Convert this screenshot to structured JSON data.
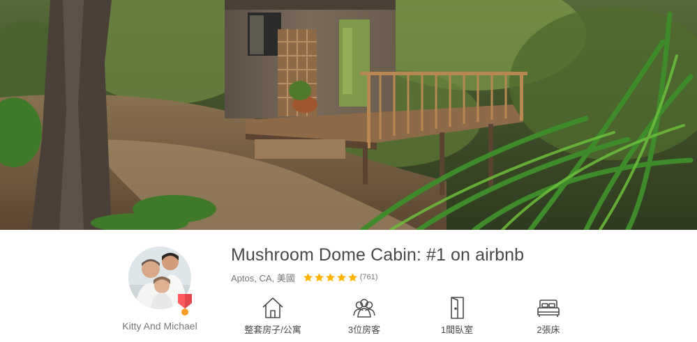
{
  "listing": {
    "title": "Mushroom Dome Cabin: #1 on airbnb",
    "location": "Aptos, CA, 美國",
    "rating_stars": 5,
    "review_count": "(761)"
  },
  "host": {
    "name": "Kitty And Michael",
    "superhost": true
  },
  "amenities": [
    {
      "icon": "house-icon",
      "label": "整套房子/公寓"
    },
    {
      "icon": "guests-icon",
      "label": "3位房客"
    },
    {
      "icon": "bedroom-door-icon",
      "label": "1間臥室"
    },
    {
      "icon": "bed-icon",
      "label": "2張床"
    }
  ],
  "colors": {
    "star": "#ffb400",
    "badge": "#ff5a5f",
    "badge_accent": "#fc9c27",
    "text_primary": "#484848",
    "text_secondary": "#767676"
  }
}
